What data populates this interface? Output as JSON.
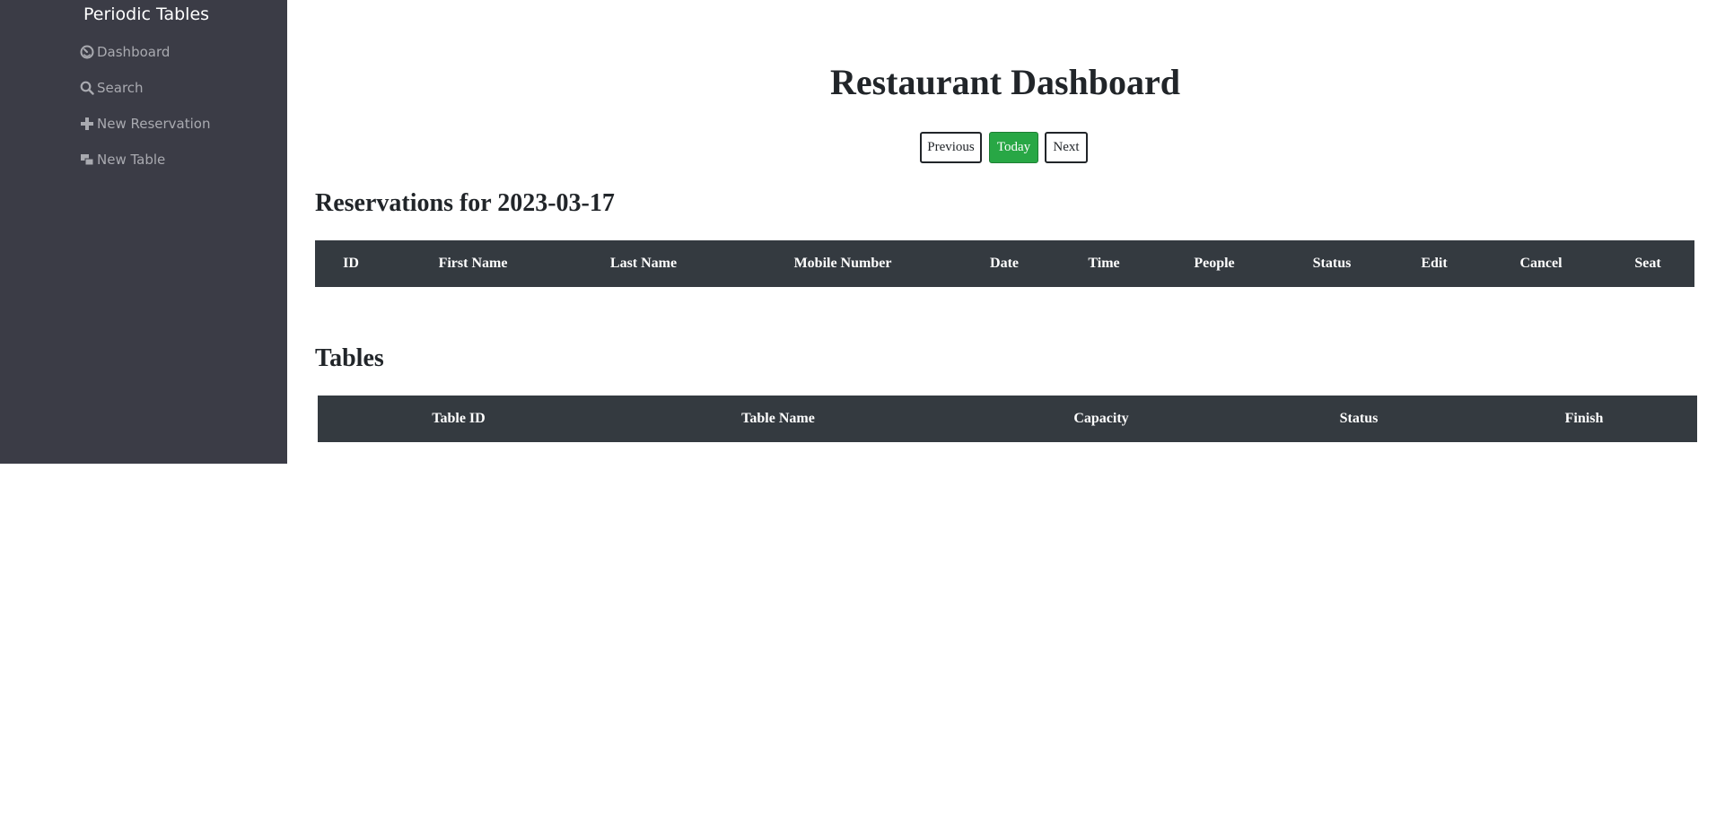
{
  "sidebar": {
    "brand": "Periodic Tables",
    "items": [
      {
        "label": "Dashboard",
        "icon": "dashboard-icon"
      },
      {
        "label": "Search",
        "icon": "search-icon"
      },
      {
        "label": "New Reservation",
        "icon": "plus-icon"
      },
      {
        "label": "New Table",
        "icon": "tables-icon"
      }
    ]
  },
  "main": {
    "title": "Restaurant Dashboard",
    "nav_buttons": {
      "previous": "Previous",
      "today": "Today",
      "next": "Next"
    },
    "reservations": {
      "heading": "Reservations for 2023-03-17",
      "columns": [
        "ID",
        "First Name",
        "Last Name",
        "Mobile Number",
        "Date",
        "Time",
        "People",
        "Status",
        "Edit",
        "Cancel",
        "Seat"
      ],
      "rows": []
    },
    "tables": {
      "heading": "Tables",
      "columns": [
        "Table ID",
        "Table Name",
        "Capacity",
        "Status",
        "Finish"
      ],
      "rows": []
    }
  },
  "colors": {
    "sidebar_bg": "#3b3c46",
    "table_header_bg": "#343a40",
    "success": "#28a745",
    "nav_text": "#a9aab0"
  }
}
